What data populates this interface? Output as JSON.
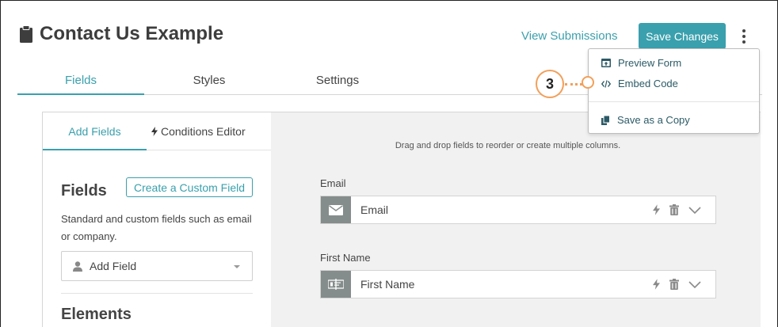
{
  "header": {
    "title": "Contact Us Example",
    "view_submissions": "View Submissions",
    "save_changes": "Save Changes"
  },
  "tabs": [
    {
      "label": "Fields"
    },
    {
      "label": "Styles"
    },
    {
      "label": "Settings"
    }
  ],
  "left_panel": {
    "sub_tabs": [
      {
        "label": "Add Fields"
      },
      {
        "label": "Conditions Editor"
      }
    ],
    "fields_heading": "Fields",
    "create_custom_field": "Create a Custom Field",
    "fields_description": "Standard and custom fields such as email or company.",
    "add_field_label": "Add Field",
    "elements_heading": "Elements"
  },
  "canvas": {
    "hint": "Drag and drop fields to reorder or create multiple columns.",
    "fields": [
      {
        "label": "Email",
        "value": "Email",
        "icon": "envelope-icon"
      },
      {
        "label": "First Name",
        "value": "First Name",
        "icon": "name-card-icon"
      }
    ]
  },
  "menu": {
    "items": [
      {
        "label": "Preview Form",
        "icon": "preview-icon"
      },
      {
        "label": "Embed Code",
        "icon": "code-icon"
      },
      {
        "label": "Save as a Copy",
        "icon": "copy-icon"
      }
    ]
  },
  "callout": {
    "number": "3"
  },
  "colors": {
    "accent": "#3aa0ad",
    "callout": "#f2a05a",
    "menu_text": "#2b5a66",
    "field_icon_bg": "#858d8c"
  }
}
